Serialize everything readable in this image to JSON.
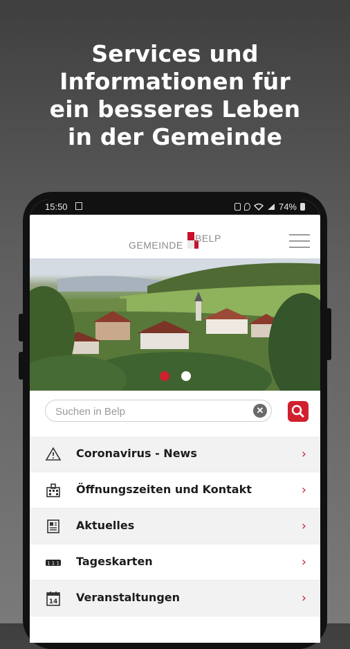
{
  "headline": {
    "line1": "Services und",
    "line2": "Informationen für",
    "line3": "ein besseres Leben",
    "line4": "in der Gemeinde"
  },
  "statusbar": {
    "time": "15:50",
    "battery": "74%"
  },
  "appbar": {
    "logo_word1": "GEMEINDE",
    "logo_word2": "BELP",
    "menu_icon": "hamburger-menu-icon"
  },
  "carousel": {
    "active_index": 0,
    "count": 2,
    "active_color": "#d0202e",
    "inactive_color": "#ffffff"
  },
  "search": {
    "placeholder": "Suchen in Belp",
    "value": ""
  },
  "menu_items": [
    {
      "label": "Coronavirus - News",
      "icon": "warning-triangle-icon"
    },
    {
      "label": "Öffnungszeiten und Kontakt",
      "icon": "building-icon"
    },
    {
      "label": "Aktuelles",
      "icon": "newspaper-icon"
    },
    {
      "label": "Tageskarten",
      "icon": "ticket-icon"
    },
    {
      "label": "Veranstaltungen",
      "icon": "calendar-icon"
    }
  ],
  "calendar_icon_day": "14",
  "ticket_icon_text": "1 1 1",
  "colors": {
    "accent": "#d0202e",
    "background": "#5f5f5f"
  }
}
